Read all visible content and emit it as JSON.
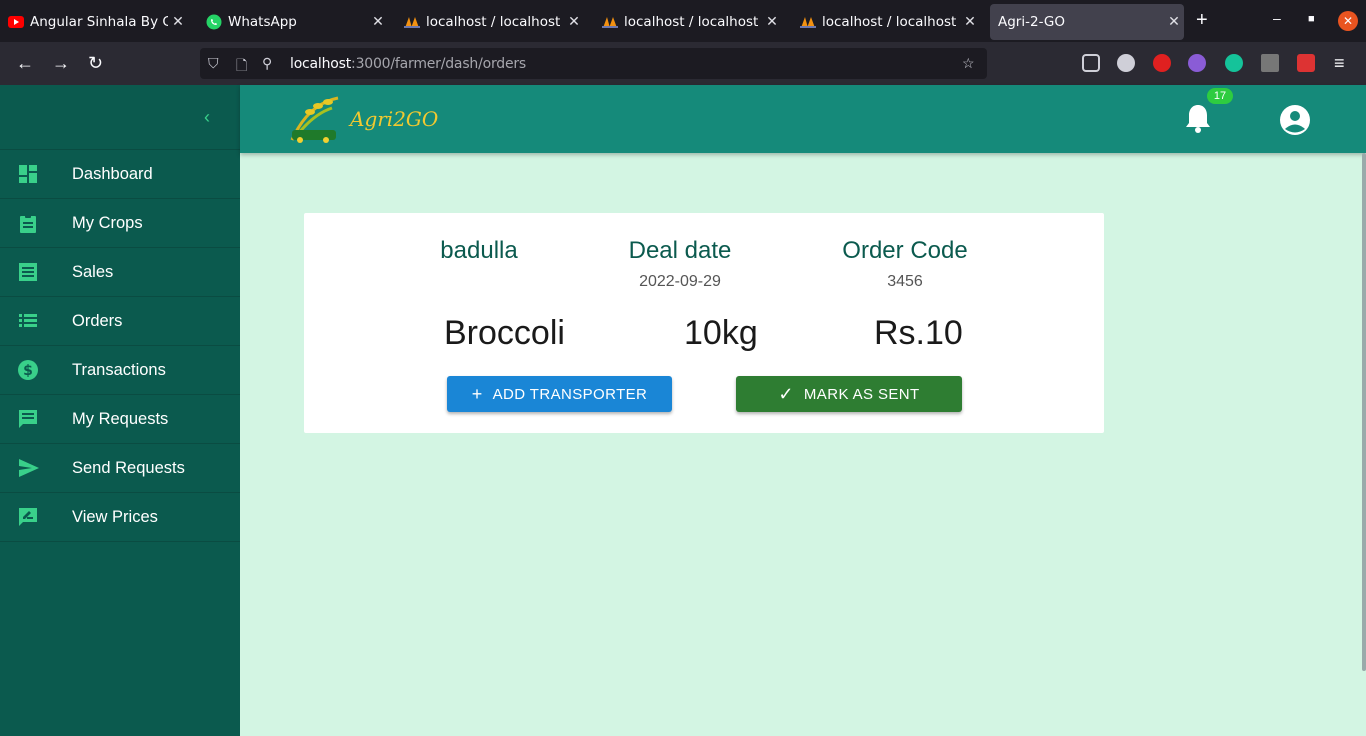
{
  "browser": {
    "tabs": [
      {
        "title": "Angular Sinhala By Cha",
        "icon": "youtube-icon"
      },
      {
        "title": "WhatsApp",
        "icon": "whatsapp-icon"
      },
      {
        "title": "localhost / localhost / ",
        "icon": "phpmyadmin-icon"
      },
      {
        "title": "localhost / localhost / ",
        "icon": "phpmyadmin-icon"
      },
      {
        "title": "localhost / localhost / ",
        "icon": "phpmyadmin-icon"
      },
      {
        "title": "Agri-2-GO",
        "icon": ""
      }
    ],
    "url_host": "localhost",
    "url_path": ":3000/farmer/dash/orders"
  },
  "app": {
    "logo_text": "Agri2GO",
    "notification_count": "17"
  },
  "sidebar": {
    "items": [
      {
        "label": "Dashboard",
        "icon": "dashboard-icon"
      },
      {
        "label": "My Crops",
        "icon": "clipboard-icon"
      },
      {
        "label": "Sales",
        "icon": "receipt-icon"
      },
      {
        "label": "Orders",
        "icon": "list-icon"
      },
      {
        "label": "Transactions",
        "icon": "dollar-icon"
      },
      {
        "label": "My Requests",
        "icon": "message-icon"
      },
      {
        "label": "Send Requests",
        "icon": "send-icon"
      },
      {
        "label": "View Prices",
        "icon": "edit-message-icon"
      }
    ]
  },
  "order": {
    "location": "badulla",
    "deal_date_label": "Deal date",
    "deal_date": "2022-09-29",
    "order_code_label": "Order Code",
    "order_code": "3456",
    "crop": "Broccoli",
    "quantity": "10kg",
    "price": "Rs.10",
    "add_transporter_label": "ADD TRANSPORTER",
    "mark_sent_label": "MARK AS SENT"
  },
  "colors": {
    "sidebar_bg": "#0b5a4e",
    "header_bg": "#158a7a",
    "page_bg": "#d3f5e3",
    "accent_green": "#39d08a"
  }
}
